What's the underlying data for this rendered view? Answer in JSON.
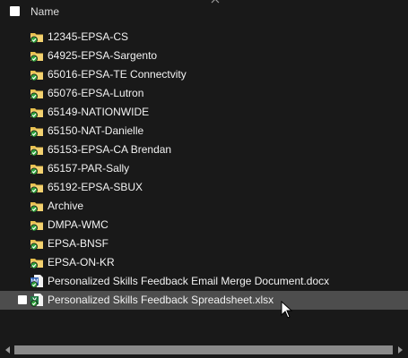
{
  "header": {
    "column_name": "Name"
  },
  "items": [
    {
      "label": "12345-EPSA-CS",
      "type": "folder"
    },
    {
      "label": "64925-EPSA-Sargento",
      "type": "folder"
    },
    {
      "label": "65016-EPSA-TE Connectvity",
      "type": "folder"
    },
    {
      "label": "65076-EPSA-Lutron",
      "type": "folder"
    },
    {
      "label": "65149-NATIONWIDE",
      "type": "folder"
    },
    {
      "label": "65150-NAT-Danielle",
      "type": "folder"
    },
    {
      "label": "65153-EPSA-CA Brendan",
      "type": "folder"
    },
    {
      "label": "65157-PAR-Sally",
      "type": "folder"
    },
    {
      "label": "65192-EPSA-SBUX",
      "type": "folder"
    },
    {
      "label": "Archive",
      "type": "folder"
    },
    {
      "label": "DMPA-WMC",
      "type": "folder"
    },
    {
      "label": "EPSA-BNSF",
      "type": "folder"
    },
    {
      "label": "EPSA-ON-KR",
      "type": "folder"
    },
    {
      "label": "Personalized Skills Feedback Email Merge Document.docx",
      "type": "docx"
    },
    {
      "label": "Personalized Skills Feedback Spreadsheet.xlsx",
      "type": "xlsx",
      "selected": true
    }
  ],
  "colors": {
    "background": "#191919",
    "selected_row": "#4d4d4d",
    "folder": "#e8c04e",
    "sync_badge": "#2fa33c",
    "word": "#2b5fb4",
    "excel": "#1f7a43"
  },
  "icons": {
    "folder": "folder-icon",
    "sync": "sync-check-icon",
    "docx": "word-doc-icon",
    "xlsx": "excel-sheet-icon"
  }
}
